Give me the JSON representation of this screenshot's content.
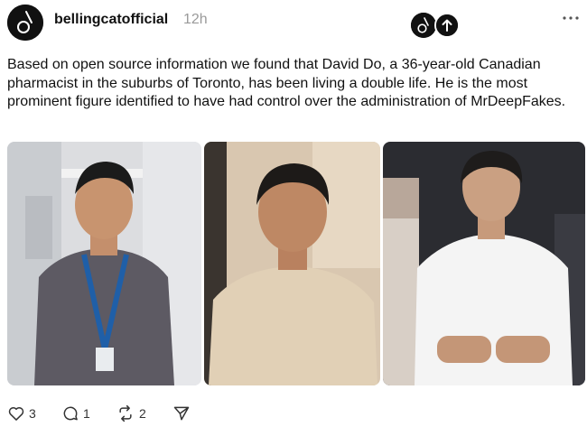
{
  "post": {
    "username": "bellingcatofficial",
    "time": "12h",
    "text": "Based on open source information we found that David Do, a 36-year-old Canadian pharmacist in the suburbs of Toronto, has been living a double life. He is the most prominent figure identified to have had control over the administration of MrDeepFakes."
  },
  "stats": {
    "likes": "3",
    "replies": "1",
    "reposts": "2"
  },
  "icons": {
    "avatar": "bellingcat-logo-icon",
    "more": "more-dots-icon",
    "like": "heart-icon",
    "reply": "comment-bubble-icon",
    "repost": "repost-arrows-icon",
    "share": "send-paper-plane-icon"
  },
  "colors": {
    "text": "#111111",
    "muted": "#9a9a9a",
    "badge": "#111111"
  }
}
